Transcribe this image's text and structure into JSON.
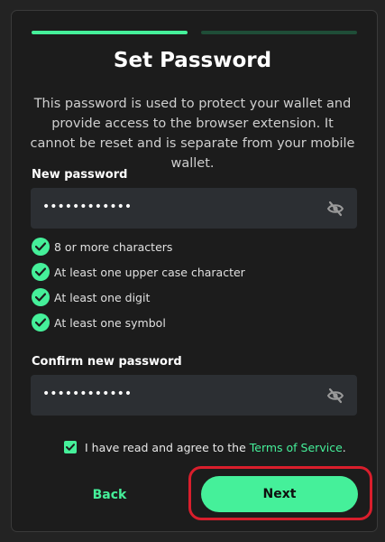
{
  "header": {
    "title": "Set Password",
    "description": "This password is used to protect your wallet and provide access to the browser extension. It cannot be reset and is separate from your mobile wallet."
  },
  "progress": {
    "current_step": 1,
    "total_steps": 2
  },
  "new_password": {
    "label": "New password",
    "value": "••••••••••••",
    "toggle_icon": "eye-slash-icon"
  },
  "requirements": [
    {
      "text": "8 or more characters",
      "met": true
    },
    {
      "text": "At least one upper case character",
      "met": true
    },
    {
      "text": "At least one digit",
      "met": true
    },
    {
      "text": "At least one symbol",
      "met": true
    }
  ],
  "confirm_password": {
    "label": "Confirm new password",
    "value": "••••••••••••",
    "toggle_icon": "eye-slash-icon"
  },
  "agreement": {
    "checked": true,
    "text": "I have read and agree to the ",
    "link_text": "Terms of Service",
    "suffix": "."
  },
  "actions": {
    "back_label": "Back",
    "next_label": "Next"
  },
  "colors": {
    "accent": "#45f09a",
    "highlight": "#d91e2c",
    "background": "#1c1c1c",
    "field": "#2c2f33"
  }
}
